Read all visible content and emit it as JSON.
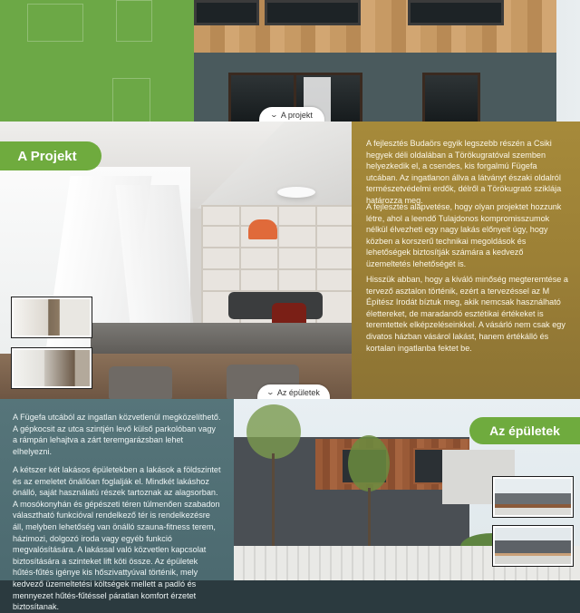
{
  "colors": {
    "green": "#6fab3e",
    "gold": "#9c8036",
    "teal": "#56757a"
  },
  "nav": {
    "project_pill": "A projekt",
    "buildings_pill": "Az épületek",
    "chevron_icon": "chevron-down-icon"
  },
  "project": {
    "heading": "A Projekt",
    "paragraphs": [
      "A fejlesztés Budaörs egyik legszebb részén a Csiki hegyek déli oldalában a Törökugratóval szemben helyezkedik el, a csendes, kis forgalmú Fügefa utcában. Az ingatlanon állva a látványt északi oldalról természetvédelmi erdők, délről a Törökugrató sziklája határozza meg.",
      "A fejlesztés alapvetése, hogy olyan projektet hozzunk létre, ahol a leendő Tulajdonos kompromisszumok nélkül élvezheti egy nagy lakás előnyeit úgy, hogy közben a korszerű technikai megoldások és lehetőségek biztosítják számára a kedvező üzemeltetés lehetőségét is.",
      "Hisszük abban, hogy a kiváló minőség megteremtése a tervező asztalon történik, ezért a tervezéssel az M Építész Irodát bíztuk meg, akik nemcsak használható élettereket, de maradandó esztétikai értékeket is teremtettek elképzeléseinkkel. A vásárló nem csak egy divatos házban vásárol lakást, hanem értékálló és kortalan ingatlanba fektet be."
    ]
  },
  "buildings": {
    "heading": "Az épületek",
    "paragraphs": [
      "A Fügefa utcából az ingatlan közvetlenül megközelíthető. A gépkocsit az utca szintjén levő külső parkolóban vagy a rámpán lehajtva a zárt teremgarázsban lehet elhelyezni.",
      "A kétszer két lakásos épületekben a lakások a földszintet és az emeletet önállóan foglalják el. Mindkét lakáshoz önálló, saját használatú részek tartoznak az alagsorban. A mosókonyhán és gépészeti téren túlmenően szabadon választható funkcióval rendelkező tér is rendelkezésre áll, melyben lehetőség van önálló szauna-fitness terem, házimozi, dolgozó iroda vagy egyéb funkció megvalósítására. A lakással való közvetlen kapcsolat biztosítására a szinteket lift köti össze. Az épületek hűtés-fűtés igénye kis hőszivattyúval történik, mely kedvező üzemeltetési költségek mellett a padló és mennyezet hűtés-fűtéssel páratlan komfort érzetet biztosítanak."
    ]
  }
}
